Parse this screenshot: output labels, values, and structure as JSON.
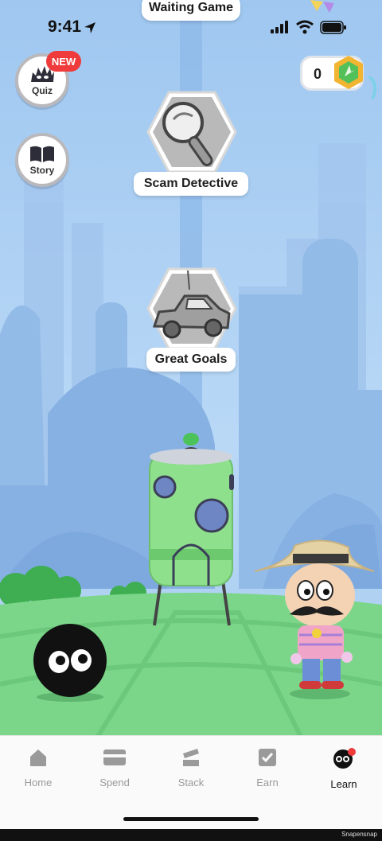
{
  "status_bar": {
    "time": "9:41"
  },
  "header": {
    "title": "Waiting Game"
  },
  "side_buttons": [
    {
      "label": "Quiz",
      "badge": "NEW",
      "icon": "spiky-monster-icon"
    },
    {
      "label": "Story",
      "icon": "book-icon"
    }
  ],
  "coins": {
    "count": "0",
    "icon": "gem-coin-icon"
  },
  "lessons": [
    {
      "label": "Scam Detective",
      "icon": "magnifying-glass-icon"
    },
    {
      "label": "Great Goals",
      "icon": "car-icon"
    }
  ],
  "tabs": [
    {
      "label": "Home",
      "icon": "house-icon",
      "active": false
    },
    {
      "label": "Spend",
      "icon": "card-icon",
      "active": false
    },
    {
      "label": "Stack",
      "icon": "stack-icon",
      "active": false
    },
    {
      "label": "Earn",
      "icon": "checkbox-icon",
      "active": false
    },
    {
      "label": "Learn",
      "icon": "monster-face-icon",
      "active": true
    }
  ],
  "footer": {
    "credit": "Snapensnap"
  },
  "colors": {
    "sky": "#a9cdf3",
    "grass": "#7bd68a",
    "accent_red": "#ef3b3b",
    "pod_green": "#8fe08c"
  }
}
